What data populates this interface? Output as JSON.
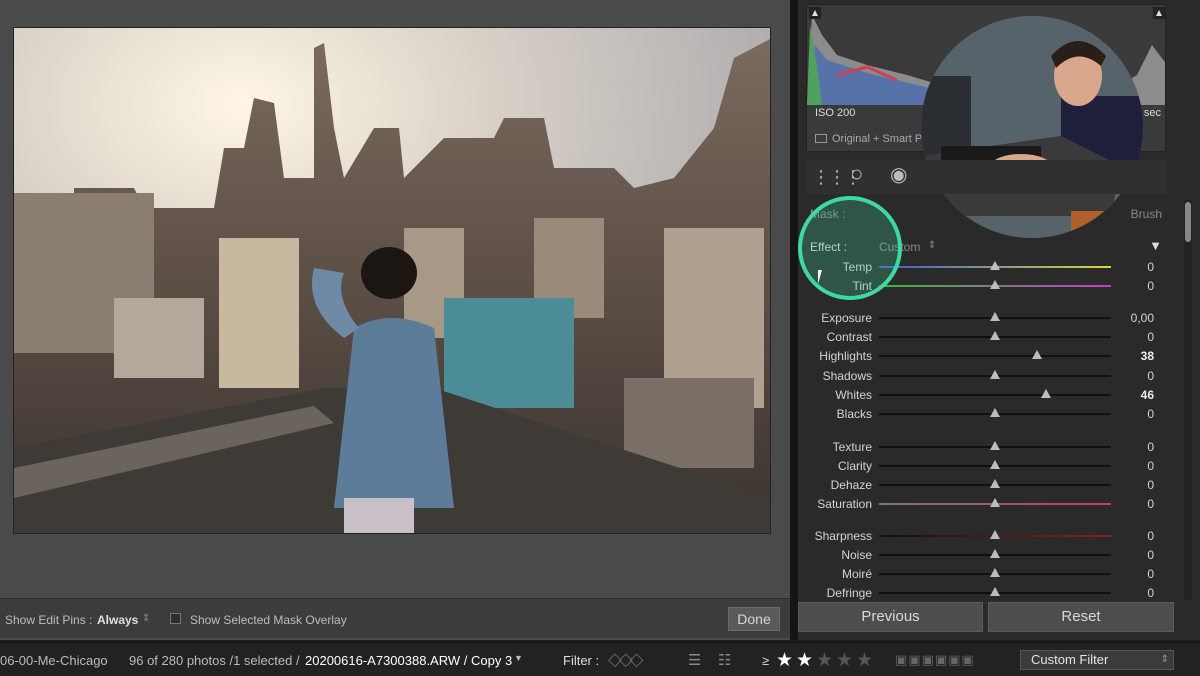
{
  "toolbar": {
    "show_edit_pins_label": "Show Edit Pins :",
    "show_edit_pins_value": "Always",
    "show_mask_overlay_label": "Show Selected Mask Overlay",
    "done_label": "Done"
  },
  "histogram": {
    "iso": "ISO 200",
    "shutter": "sec",
    "original_label": "Original + Smart P"
  },
  "mask": {
    "label": "Mask :",
    "brush_label": "Brush",
    "effect_label": "Effect :",
    "effect_value": "Custom"
  },
  "sliders": [
    {
      "name": "Temp",
      "value": "0",
      "pos": 0.5
    },
    {
      "name": "Tint",
      "value": "0",
      "pos": 0.5
    },
    {
      "name": "Exposure",
      "value": "0,00",
      "pos": 0.5
    },
    {
      "name": "Contrast",
      "value": "0",
      "pos": 0.5
    },
    {
      "name": "Highlights",
      "value": "38",
      "pos": 0.68
    },
    {
      "name": "Shadows",
      "value": "0",
      "pos": 0.5
    },
    {
      "name": "Whites",
      "value": "46",
      "pos": 0.72
    },
    {
      "name": "Blacks",
      "value": "0",
      "pos": 0.5
    },
    {
      "name": "Texture",
      "value": "0",
      "pos": 0.5
    },
    {
      "name": "Clarity",
      "value": "0",
      "pos": 0.5
    },
    {
      "name": "Dehaze",
      "value": "0",
      "pos": 0.5
    },
    {
      "name": "Saturation",
      "value": "0",
      "pos": 0.5
    },
    {
      "name": "Sharpness",
      "value": "0",
      "pos": 0.5
    },
    {
      "name": "Noise",
      "value": "0",
      "pos": 0.5
    },
    {
      "name": "Moiré",
      "value": "0",
      "pos": 0.5
    },
    {
      "name": "Defringe",
      "value": "0",
      "pos": 0.5
    }
  ],
  "buttons": {
    "previous": "Previous",
    "reset": "Reset"
  },
  "filmstrip": {
    "folder": "06-00-Me-Chicago",
    "count": "96 of 280 photos /1 selected /",
    "filename": "20200616-A7300388.ARW / Copy 3",
    "filter_label": "Filter :",
    "rating_op": "≥",
    "stars_selected": 2,
    "stars_total": 5,
    "custom_filter": "Custom Filter"
  },
  "colors": {
    "accent_green": "#3fd9a0",
    "panel": "#2a2a2a",
    "background": "#4a4a4a"
  }
}
